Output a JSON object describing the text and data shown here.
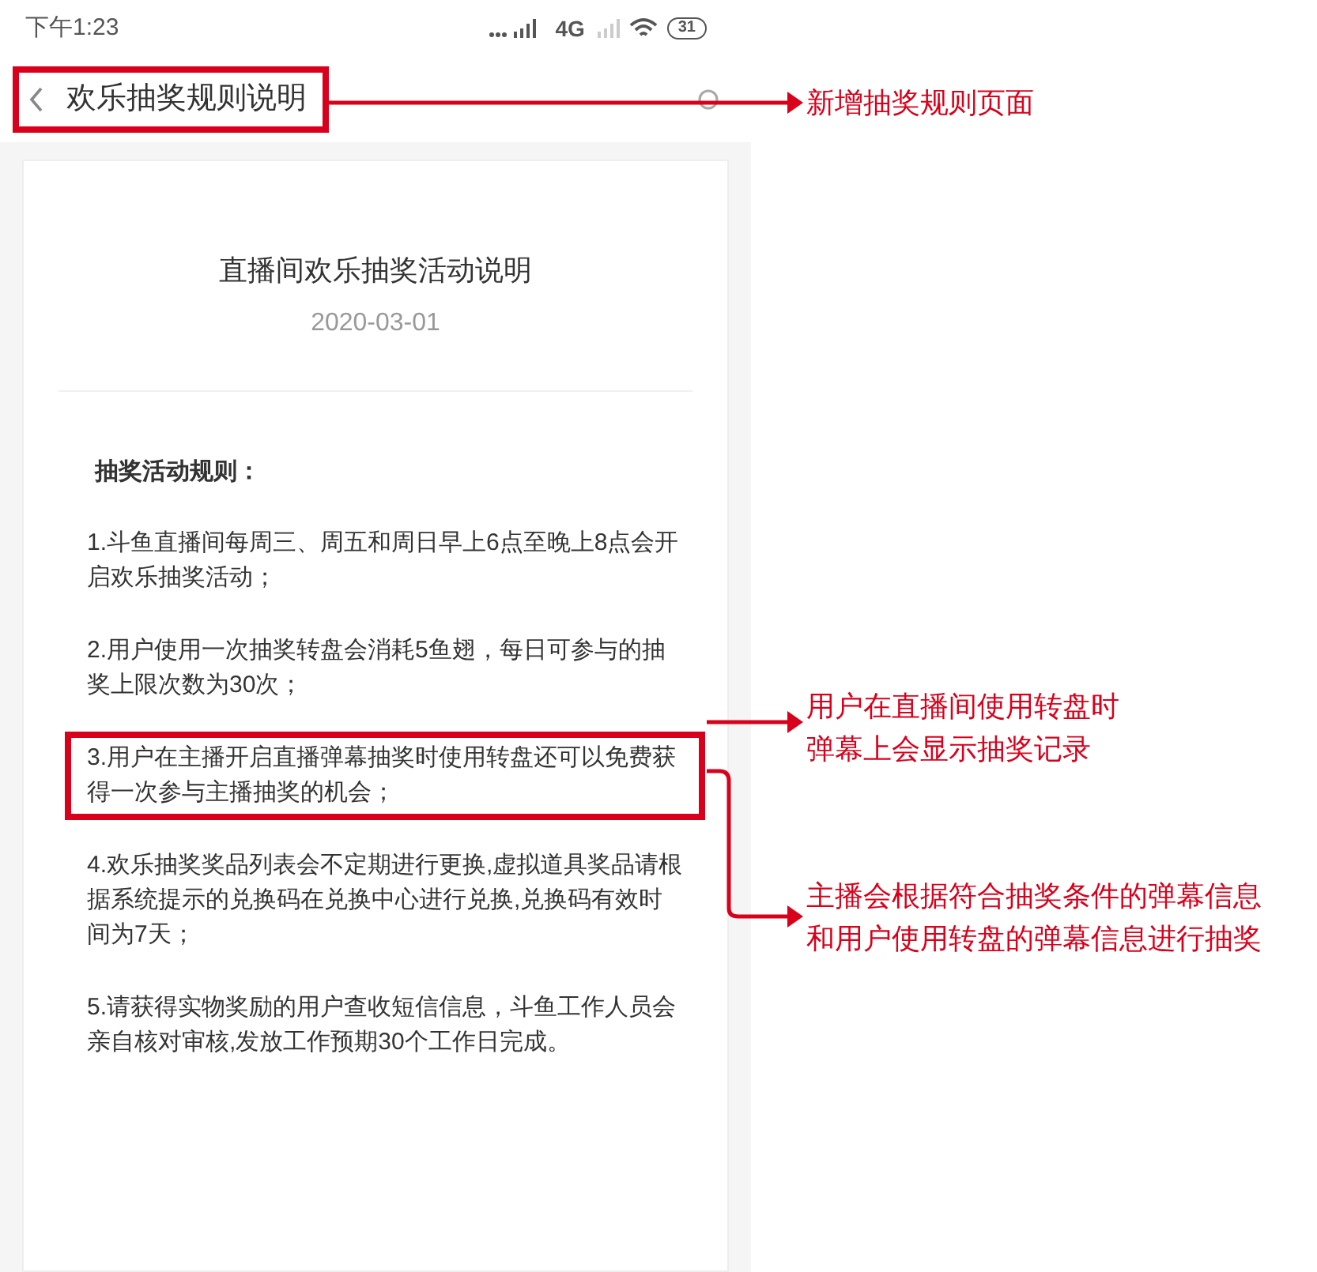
{
  "status_bar": {
    "time": "下午1:23",
    "network": "4G",
    "battery": "31"
  },
  "nav": {
    "title": "欢乐抽奖规则说明",
    "highlighted": true
  },
  "article": {
    "title": "直播间欢乐抽奖活动说明",
    "date": "2020-03-01",
    "heading": "抽奖活动规则：",
    "rules": [
      {
        "text": "1.斗鱼直播间每周三、周五和周日早上6点至晚上8点会开启欢乐抽奖活动；",
        "highlighted": false
      },
      {
        "text": "2.用户使用一次抽奖转盘会消耗5鱼翅，每日可参与的抽奖上限次数为30次；",
        "highlighted": false
      },
      {
        "text": "3.用户在主播开启直播弹幕抽奖时使用转盘还可以免费获得一次参与主播抽奖的机会；",
        "highlighted": true
      },
      {
        "text": "4.欢乐抽奖奖品列表会不定期进行更换,虚拟道具奖品请根据系统提示的兑换码在兑换中心进行兑换,兑换码有效时间为7天；",
        "highlighted": false
      },
      {
        "text": "5.请获得实物奖励的用户查收短信信息，斗鱼工作人员会亲自核对审核,发放工作预期30个工作日完成。",
        "highlighted": false
      }
    ]
  },
  "annotations": [
    {
      "lines": [
        "新增抽奖规则页面"
      ]
    },
    {
      "lines": [
        "用户在直播间使用转盘时",
        "弹幕上会显示抽奖记录"
      ]
    },
    {
      "lines": [
        "主播会根据符合抽奖条件的弹幕信息",
        "和用户使用转盘的弹幕信息进行抽奖"
      ]
    }
  ]
}
